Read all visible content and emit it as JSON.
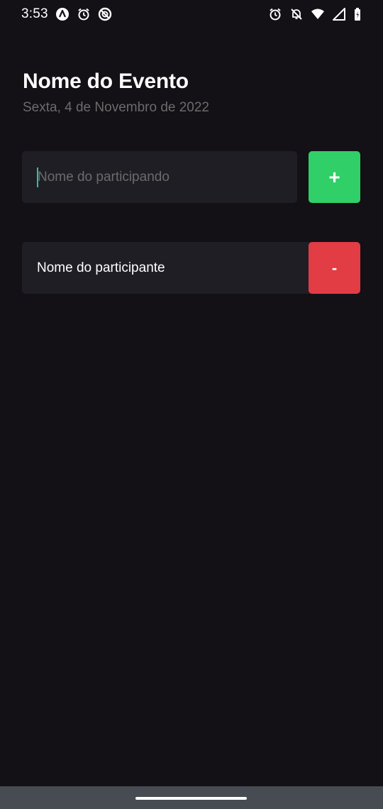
{
  "status_bar": {
    "time": "3:53",
    "left_icons": [
      "app-a-icon",
      "alarm-icon",
      "blocked-notification-icon"
    ],
    "right_icons": [
      "alarm-icon",
      "notifications-off-icon",
      "wifi-icon",
      "signal-icon",
      "battery-icon"
    ]
  },
  "header": {
    "title": "Nome do Evento",
    "date": "Sexta, 4 de Novembro de 2022"
  },
  "form": {
    "placeholder": "Nome do participando",
    "value": "",
    "add_label": "+"
  },
  "participants": [
    {
      "name": "Nome do participante",
      "remove_label": "-"
    }
  ],
  "colors": {
    "background": "#131016",
    "card": "#1f1e25",
    "add": "#31cf67",
    "remove": "#e23c44",
    "muted_text": "#6b6b6b",
    "caret": "#2ac0a8"
  }
}
